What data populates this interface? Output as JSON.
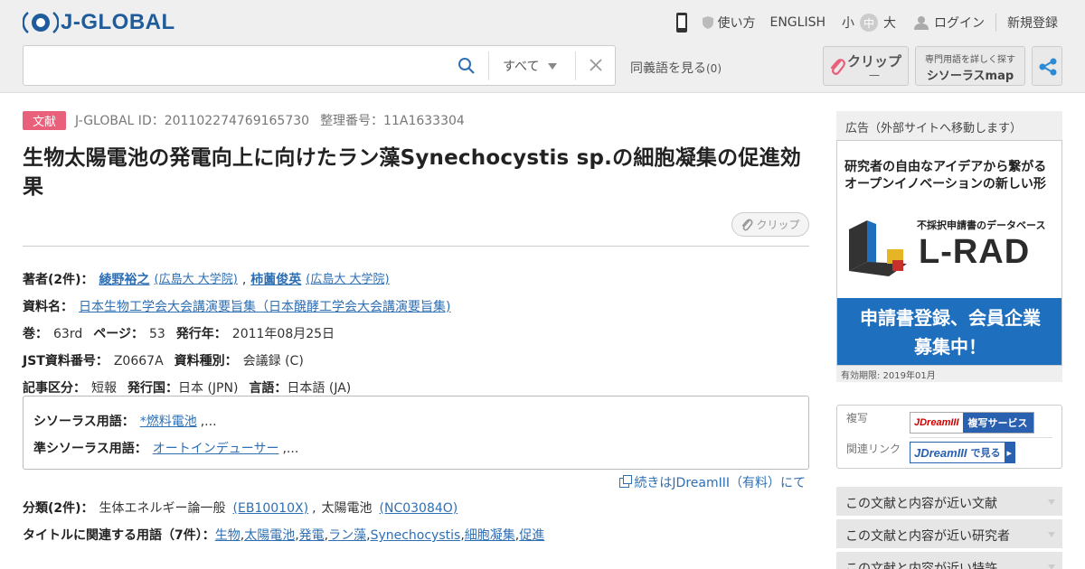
{
  "header": {
    "logo_text": "J-GLOBAL",
    "nav": {
      "how_to": "使い方",
      "english": "ENGLISH",
      "size_small": "小",
      "size_mid": "中",
      "size_large": "大",
      "login": "ログイン",
      "register": "新規登録"
    },
    "search": {
      "value": "",
      "scope": "すべて"
    },
    "synonyms_label": "同義語を見る",
    "synonyms_count": "(0)",
    "clip_label": "クリップ",
    "clip_count": "—",
    "thesaurus_top": "専門用語を詳しく探す",
    "thesaurus_bottom": "シソーラスmap"
  },
  "article": {
    "type_tag": "文献",
    "jglobal_id": "J-GLOBAL ID：201102274769165730",
    "ref_no": "整理番号：11A1633304",
    "title": "生物太陽電池の発電向上に向けたラン藻Synechocystis sp.の細胞凝集の促進効果",
    "clip_label": "クリップ",
    "authors_label": "著者(2件)：",
    "authors": [
      {
        "name": "綾野裕之",
        "affil": "(広島大 大学院)"
      },
      {
        "name": "柿薗俊英",
        "affil": "(広島大 大学院)"
      }
    ],
    "source_label": "資料名：",
    "source": "日本生物工学会大会講演要旨集（日本醗酵工学会大会講演要旨集)",
    "volume_label": "巻：",
    "volume": "63rd",
    "page_label": "ページ：",
    "page": "53",
    "pubyear_label": "発行年：",
    "pubyear": "2011年08月25日",
    "jst_label": "JST資料番号：",
    "jst": "Z0667A",
    "doctype_label": "資料種別：",
    "doctype": "会議録 (C)",
    "category_label": "記事区分：",
    "category": "短報",
    "country_label": "発行国：",
    "country": "日本 (JPN)",
    "lang_label": "言語：",
    "lang": "日本語 (JA)",
    "thes_label": "シソーラス用語：",
    "thes_term": "*燃料電池",
    "thes_more": ",...",
    "quasi_label": "準シソーラス用語：",
    "quasi_term": "オートインデューサー",
    "quasi_more": ",...",
    "more_link": "続きはJDreamIII（有料）にて",
    "class_label": "分類(2件)：",
    "classes": [
      {
        "name": "生体エネルギー論一般",
        "code": "(EB10010X)"
      },
      {
        "name": "太陽電池",
        "code": "(NC03084O)"
      }
    ],
    "terms_label": "タイトルに関連する用語（7件）：",
    "terms": [
      "生物",
      "太陽電池",
      "発電",
      "ラン藻",
      "Synechocystis",
      "細胞凝集",
      "促進"
    ]
  },
  "sidebar": {
    "ad_header": "広告（外部サイトへ移動します）",
    "ad_line1": "研究者の自由なアイデアから繋がる",
    "ad_line2": "オープンイノベーションの新しい形",
    "ad_sub": "不採択申請書のデータベース",
    "ad_brand": "L-RAD",
    "ad_cta1": "申請書登録、会員企業",
    "ad_cta2": "募集中！",
    "ad_expiry": "有効期限: 2019年01月",
    "copy_label": "複写",
    "copy_btn": "複写サービス",
    "related_label": "関連リンク",
    "related_btn": "で見る",
    "jdream": "JDreamIII",
    "acc1": "この文献と内容が近い文献",
    "acc2": "この文献と内容が近い研究者",
    "acc3": "この文献と内容が近い特許"
  }
}
